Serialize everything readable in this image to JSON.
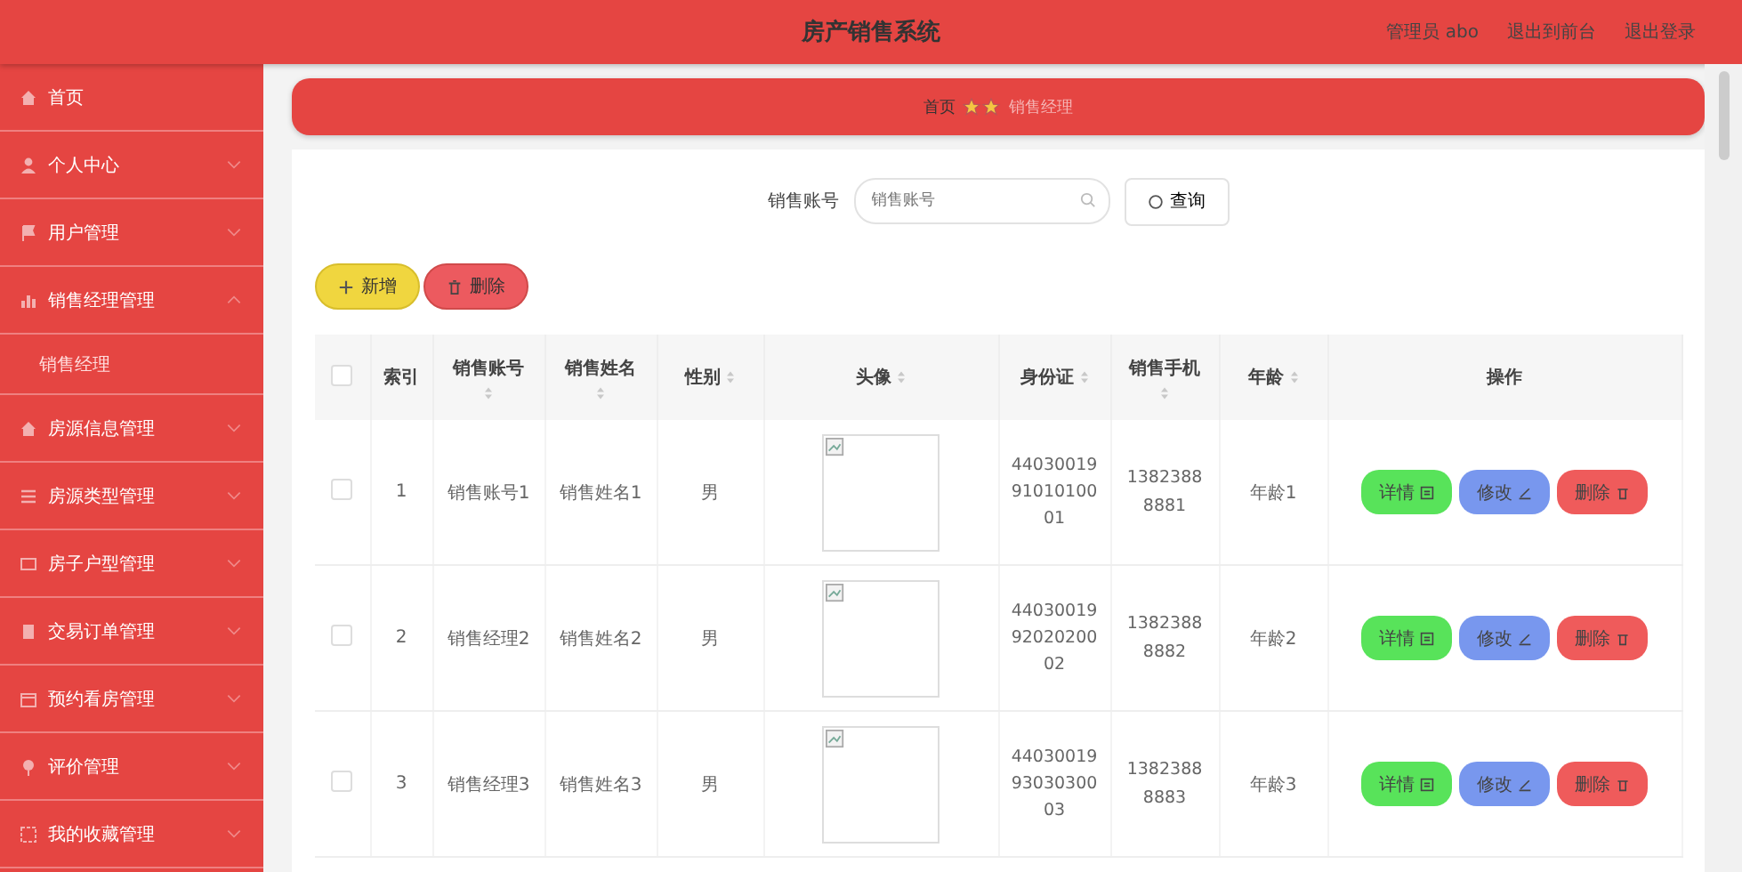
{
  "header": {
    "title": "房产销售系统",
    "links": [
      "管理员 abo",
      "退出到前台",
      "退出登录"
    ]
  },
  "sidebar": {
    "items": [
      {
        "label": "首页"
      },
      {
        "label": "个人中心",
        "expanded": false
      },
      {
        "label": "用户管理",
        "expanded": false
      },
      {
        "label": "销售经理管理",
        "expanded": true,
        "children": [
          {
            "label": "销售经理"
          }
        ]
      },
      {
        "label": "房源信息管理",
        "expanded": false
      },
      {
        "label": "房源类型管理",
        "expanded": false
      },
      {
        "label": "房子户型管理",
        "expanded": false
      },
      {
        "label": "交易订单管理",
        "expanded": false
      },
      {
        "label": "预约看房管理",
        "expanded": false
      },
      {
        "label": "评价管理",
        "expanded": false
      },
      {
        "label": "我的收藏管理",
        "expanded": false
      }
    ]
  },
  "breadcrumb": [
    "首页",
    "销售经理"
  ],
  "search": {
    "label": "销售账号",
    "placeholder": "销售账号",
    "button": "查询"
  },
  "actions": [
    "新增",
    "删除"
  ],
  "table": {
    "all_checked": false,
    "columns": [
      {
        "label": "索引",
        "sortable": false
      },
      {
        "label": "销售账号",
        "sortable": true
      },
      {
        "label": "销售姓名",
        "sortable": true
      },
      {
        "label": "性别",
        "sortable": true
      },
      {
        "label": "头像",
        "sortable": true
      },
      {
        "label": "身份证",
        "sortable": true
      },
      {
        "label": "销售手机",
        "sortable": true
      },
      {
        "label": "年龄",
        "sortable": true
      },
      {
        "label": "操作",
        "sortable": false
      }
    ],
    "rows": [
      {
        "checked": false,
        "index": "1",
        "account": "销售账号1",
        "name": "销售姓名1",
        "gender": "男",
        "id_card": "440300199101010001",
        "phone": "13823888881",
        "age": "年龄1",
        "buttons": [
          "详情",
          "修改",
          "删除"
        ]
      },
      {
        "checked": false,
        "index": "2",
        "account": "销售经理2",
        "name": "销售姓名2",
        "gender": "男",
        "id_card": "440300199202020002",
        "phone": "13823888882",
        "age": "年龄2",
        "buttons": [
          "详情",
          "修改",
          "删除"
        ]
      },
      {
        "checked": false,
        "index": "3",
        "account": "销售经理3",
        "name": "销售姓名3",
        "gender": "男",
        "id_card": "440300199303030003",
        "phone": "13823888883",
        "age": "年龄3",
        "buttons": [
          "详情",
          "修改",
          "删除"
        ]
      }
    ]
  }
}
